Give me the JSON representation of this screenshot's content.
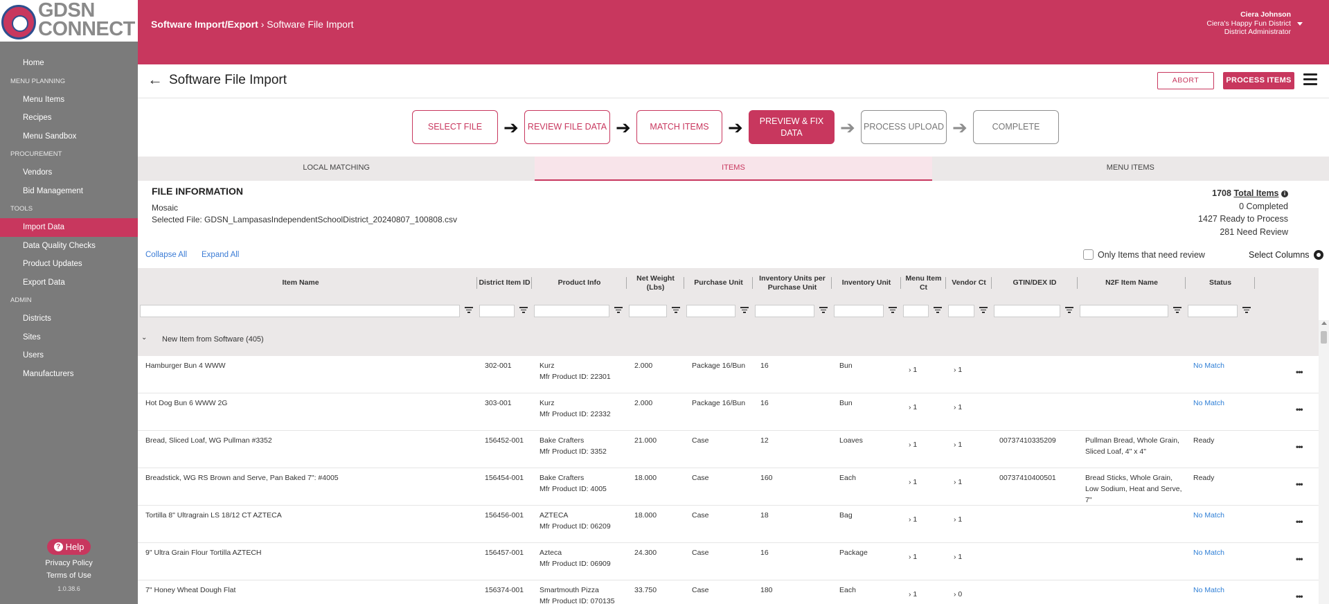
{
  "logo": {
    "line1": "GDSN",
    "line2": "CONNECT"
  },
  "sidebar": {
    "items": [
      {
        "type": "item",
        "label": "Home"
      },
      {
        "type": "section",
        "label": "MENU PLANNING"
      },
      {
        "type": "item",
        "label": "Menu Items"
      },
      {
        "type": "item",
        "label": "Recipes"
      },
      {
        "type": "item",
        "label": "Menu Sandbox"
      },
      {
        "type": "section",
        "label": "PROCUREMENT"
      },
      {
        "type": "item",
        "label": "Vendors"
      },
      {
        "type": "item",
        "label": "Bid Management"
      },
      {
        "type": "section",
        "label": "TOOLS"
      },
      {
        "type": "item",
        "label": "Import Data",
        "active": true
      },
      {
        "type": "item",
        "label": "Data Quality Checks"
      },
      {
        "type": "item",
        "label": "Product Updates"
      },
      {
        "type": "item",
        "label": "Export Data"
      },
      {
        "type": "section",
        "label": "ADMIN"
      },
      {
        "type": "item",
        "label": "Districts"
      },
      {
        "type": "item",
        "label": "Sites"
      },
      {
        "type": "item",
        "label": "Users"
      },
      {
        "type": "item",
        "label": "Manufacturers"
      }
    ],
    "help_label": "Help",
    "privacy_label": "Privacy Policy",
    "terms_label": "Terms of Use",
    "version": "1.0.38.6"
  },
  "header": {
    "breadcrumb_parent": "Software Import/Export",
    "breadcrumb_sep": "›",
    "breadcrumb_current": "Software File Import",
    "user_name": "Ciera Johnson",
    "user_district": "Ciera's Happy Fun District",
    "user_role": "District Administrator"
  },
  "titlebar": {
    "back_icon": "←",
    "title": "Software File Import",
    "abort_label": "ABORT",
    "process_label": "PROCESS ITEMS"
  },
  "steps": [
    {
      "label": "SELECT FILE",
      "state": "done"
    },
    {
      "label": "REVIEW FILE DATA",
      "state": "done"
    },
    {
      "label": "MATCH ITEMS",
      "state": "done"
    },
    {
      "label": "PREVIEW & FIX DATA",
      "state": "current"
    },
    {
      "label": "PROCESS UPLOAD",
      "state": "future"
    },
    {
      "label": "COMPLETE",
      "state": "future"
    }
  ],
  "tabs": [
    {
      "label": "LOCAL MATCHING",
      "active": false
    },
    {
      "label": "ITEMS",
      "active": true
    },
    {
      "label": "MENU ITEMS",
      "active": false
    }
  ],
  "file_info": {
    "title": "FILE INFORMATION",
    "software": "Mosaic",
    "selected_file": "Selected File: GDSN_LampasasIndependentSchoolDistrict_20240807_100808.csv"
  },
  "stats": {
    "total_count": "1708",
    "total_label": "Total Items",
    "completed": "0 Completed",
    "ready": "1427 Ready to Process",
    "review": "281 Need Review"
  },
  "toolbar": {
    "collapse_label": "Collapse All",
    "expand_label": "Expand All",
    "review_filter_label": "Only Items that need review",
    "select_columns_label": "Select Columns"
  },
  "table": {
    "columns": [
      {
        "key": "item_name",
        "label": "Item Name"
      },
      {
        "key": "district_item_id",
        "label": "District Item ID"
      },
      {
        "key": "product_info",
        "label": "Product Info"
      },
      {
        "key": "net_weight",
        "label": "Net Weight (Lbs)"
      },
      {
        "key": "purchase_unit",
        "label": "Purchase Unit"
      },
      {
        "key": "inv_per_purchase",
        "label": "Inventory Units per Purchase Unit"
      },
      {
        "key": "inventory_unit",
        "label": "Inventory Unit"
      },
      {
        "key": "menu_item_ct",
        "label": "Menu Item Ct"
      },
      {
        "key": "vendor_ct",
        "label": "Vendor Ct"
      },
      {
        "key": "gtin",
        "label": "GTIN/DEX ID"
      },
      {
        "key": "n2f_name",
        "label": "N2F Item Name"
      },
      {
        "key": "status",
        "label": "Status"
      }
    ],
    "group_label": "New Item from Software (405)",
    "rows": [
      {
        "item_name": "Hamburger Bun 4 WWW",
        "district_item_id": "302-001",
        "mfr": "Kurz",
        "mfr_id": "Mfr Product ID: 22301",
        "net_weight": "2.000",
        "purchase_unit": "Package 16/Bun",
        "inv_per_purchase": "16",
        "inventory_unit": "Bun",
        "menu_item_ct": "1",
        "vendor_ct": "1",
        "gtin": "",
        "n2f_name": "",
        "status": "No Match"
      },
      {
        "item_name": "Hot Dog Bun 6 WWW 2G",
        "district_item_id": "303-001",
        "mfr": "Kurz",
        "mfr_id": "Mfr Product ID: 22332",
        "net_weight": "2.000",
        "purchase_unit": "Package 16/Bun",
        "inv_per_purchase": "16",
        "inventory_unit": "Bun",
        "menu_item_ct": "1",
        "vendor_ct": "1",
        "gtin": "",
        "n2f_name": "",
        "status": "No Match"
      },
      {
        "item_name": "Bread, Sliced Loaf, WG Pullman #3352",
        "district_item_id": "156452-001",
        "mfr": "Bake Crafters",
        "mfr_id": "Mfr Product ID: 3352",
        "net_weight": "21.000",
        "purchase_unit": "Case",
        "inv_per_purchase": "12",
        "inventory_unit": "Loaves",
        "menu_item_ct": "1",
        "vendor_ct": "1",
        "gtin": "00737410335209",
        "n2f_name": "Pullman Bread, Whole Grain, Sliced Loaf, 4\" x 4\"",
        "status": "Ready"
      },
      {
        "item_name": "Breadstick, WG RS Brown and Serve, Pan Baked 7\": #4005",
        "district_item_id": "156454-001",
        "mfr": "Bake Crafters",
        "mfr_id": "Mfr Product ID: 4005",
        "net_weight": "18.000",
        "purchase_unit": "Case",
        "inv_per_purchase": "160",
        "inventory_unit": "Each",
        "menu_item_ct": "1",
        "vendor_ct": "1",
        "gtin": "00737410400501",
        "n2f_name": "Bread Sticks, Whole Grain, Low Sodium, Heat and Serve, 7\"",
        "status": "Ready"
      },
      {
        "item_name": "Tortilla 8\" Ultragrain LS 18/12 CT AZTECA",
        "district_item_id": "156456-001",
        "mfr": "AZTECA",
        "mfr_id": "Mfr Product ID: 06209",
        "net_weight": "18.000",
        "purchase_unit": "Case",
        "inv_per_purchase": "18",
        "inventory_unit": "Bag",
        "menu_item_ct": "1",
        "vendor_ct": "1",
        "gtin": "",
        "n2f_name": "",
        "status": "No Match"
      },
      {
        "item_name": "9\" Ultra Grain Flour Tortilla AZTECH",
        "district_item_id": "156457-001",
        "mfr": "Azteca",
        "mfr_id": "Mfr Product ID: 06909",
        "net_weight": "24.300",
        "purchase_unit": "Case",
        "inv_per_purchase": "16",
        "inventory_unit": "Package",
        "menu_item_ct": "1",
        "vendor_ct": "1",
        "gtin": "",
        "n2f_name": "",
        "status": "No Match"
      },
      {
        "item_name": "7\" Honey Wheat Dough Flat",
        "district_item_id": "156374-001",
        "mfr": "Smartmouth Pizza",
        "mfr_id": "Mfr Product ID: 070135",
        "net_weight": "33.750",
        "purchase_unit": "Case",
        "inv_per_purchase": "180",
        "inventory_unit": "Each",
        "menu_item_ct": "1",
        "vendor_ct": "0",
        "gtin": "",
        "n2f_name": "",
        "status": "No Match"
      }
    ]
  },
  "colors": {
    "brand": "#c8375e",
    "sidebar": "#7b7b7b",
    "link": "#2f7fd6"
  },
  "icons": {
    "back": "arrow-left-icon",
    "menu": "hamburger-icon",
    "gear": "gear-icon",
    "filter": "filter-icon",
    "info": "info-icon",
    "help": "question-icon",
    "caret": "chevron-down-icon",
    "row_actions": "more-dots-icon"
  }
}
